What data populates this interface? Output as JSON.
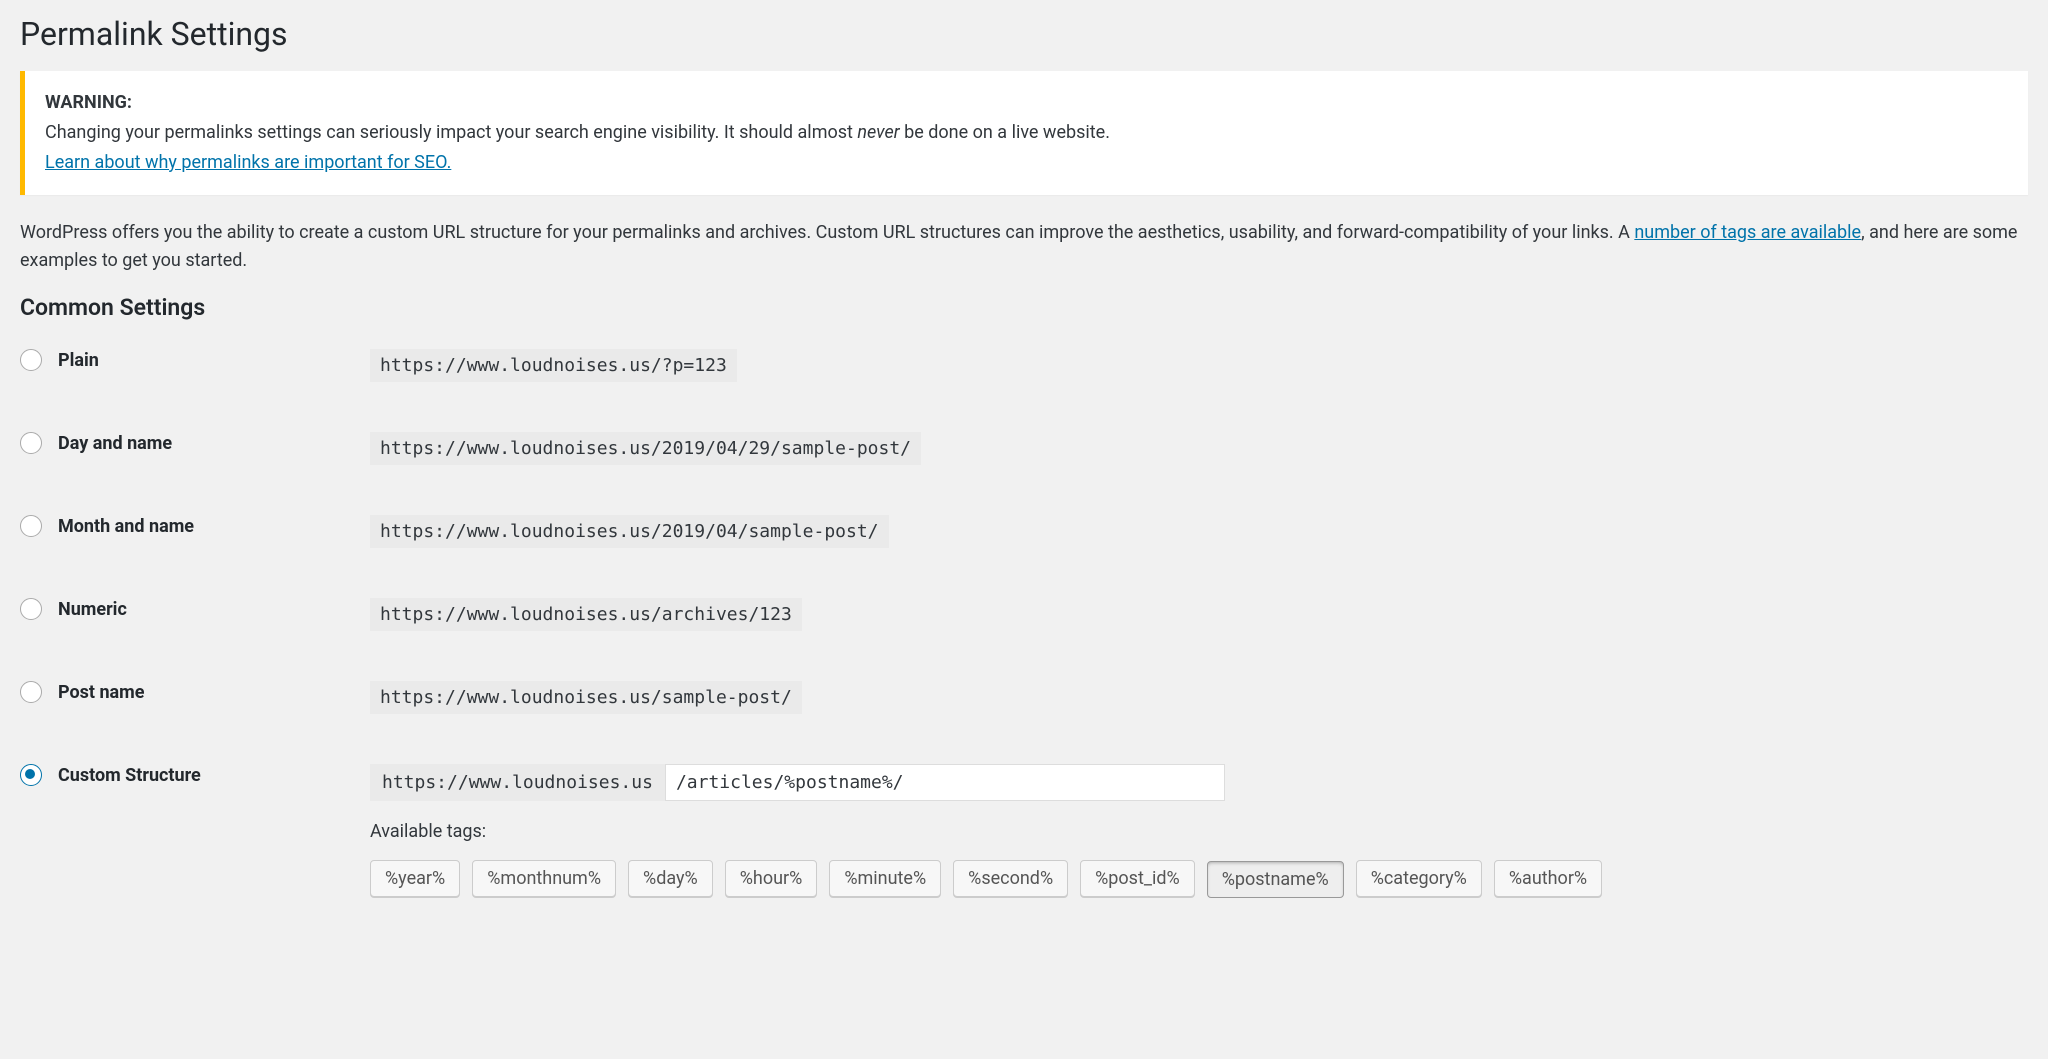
{
  "title": "Permalink Settings",
  "warning": {
    "label": "WARNING:",
    "text_before": "Changing your permalinks settings can seriously impact your search engine visibility. It should almost ",
    "em": "never",
    "text_after": " be done on a live website.",
    "link": "Learn about why permalinks are important for SEO."
  },
  "intro": {
    "before_link": "WordPress offers you the ability to create a custom URL structure for your permalinks and archives. Custom URL structures can improve the aesthetics, usability, and forward-compatibility of your links. A ",
    "link": "number of tags are available",
    "after_link": ", and here are some examples to get you started."
  },
  "section_heading": "Common Settings",
  "options": {
    "plain": {
      "label": "Plain",
      "url": "https://www.loudnoises.us/?p=123"
    },
    "day_name": {
      "label": "Day and name",
      "url": "https://www.loudnoises.us/2019/04/29/sample-post/"
    },
    "month_name": {
      "label": "Month and name",
      "url": "https://www.loudnoises.us/2019/04/sample-post/"
    },
    "numeric": {
      "label": "Numeric",
      "url": "https://www.loudnoises.us/archives/123"
    },
    "post_name": {
      "label": "Post name",
      "url": "https://www.loudnoises.us/sample-post/"
    },
    "custom": {
      "label": "Custom Structure",
      "base": "https://www.loudnoises.us",
      "value": "/articles/%postname%/"
    }
  },
  "available_tags_label": "Available tags:",
  "tags": [
    "%year%",
    "%monthnum%",
    "%day%",
    "%hour%",
    "%minute%",
    "%second%",
    "%post_id%",
    "%postname%",
    "%category%",
    "%author%"
  ],
  "active_tag": "%postname%"
}
